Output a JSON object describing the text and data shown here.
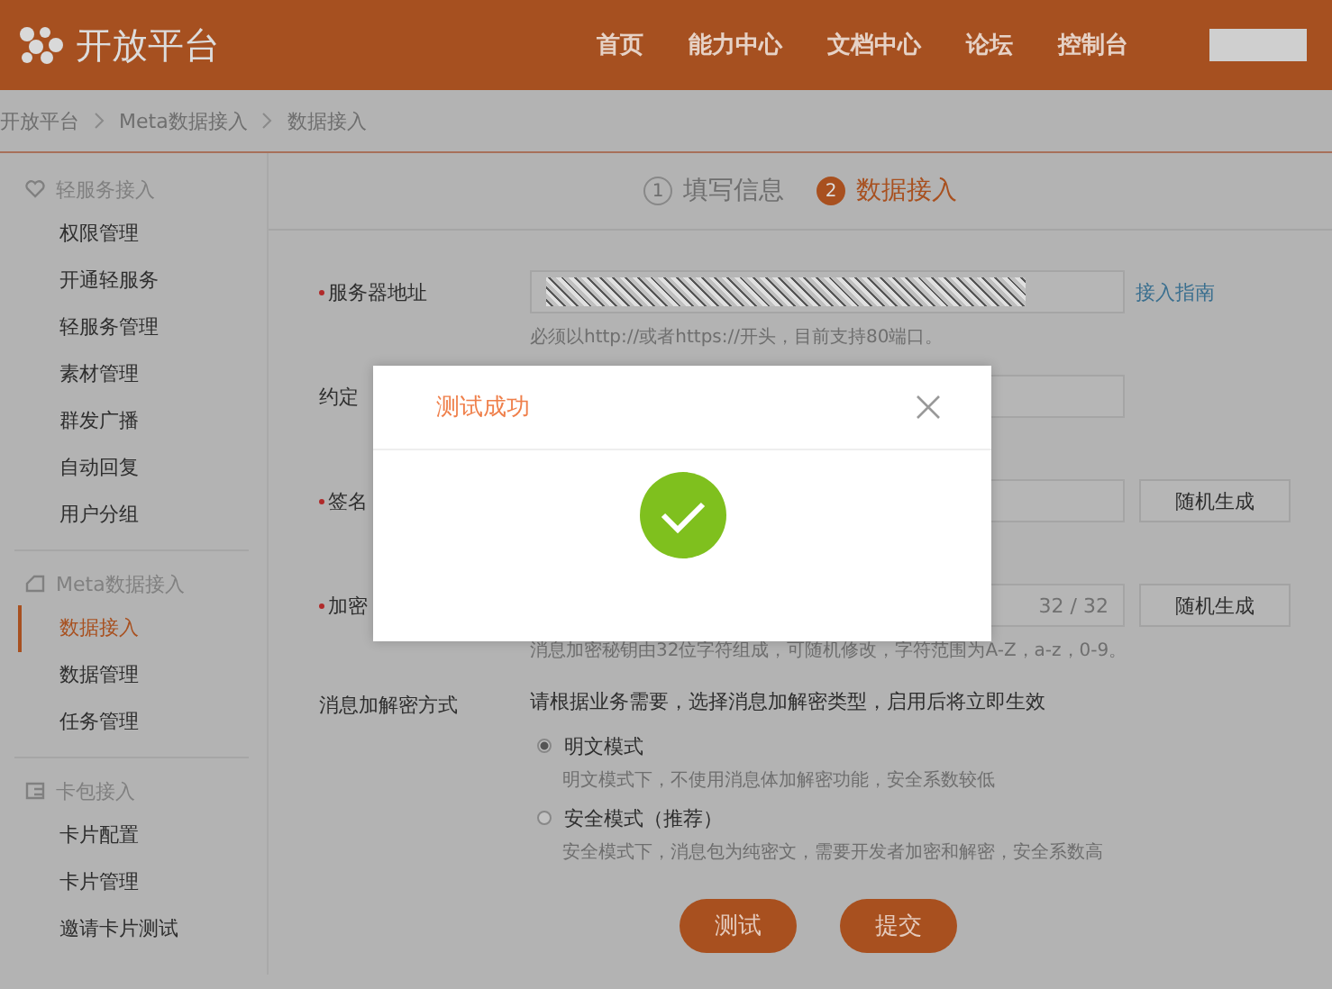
{
  "header": {
    "logo": "开放平台",
    "nav": [
      "首页",
      "能力中心",
      "文档中心",
      "论坛",
      "控制台"
    ]
  },
  "breadcrumb": [
    "开放平台",
    "Meta数据接入",
    "数据接入"
  ],
  "sidebar": {
    "sections": [
      {
        "title": "轻服务接入",
        "kind": "heart",
        "items": [
          {
            "label": "权限管理",
            "selected": false
          },
          {
            "label": "开通轻服务",
            "selected": false
          },
          {
            "label": "轻服务管理",
            "selected": false
          },
          {
            "label": "素材管理",
            "selected": false
          },
          {
            "label": "群发广播",
            "selected": false
          },
          {
            "label": "自动回复",
            "selected": false
          },
          {
            "label": "用户分组",
            "selected": false
          }
        ]
      },
      {
        "title": "Meta数据接入",
        "kind": "tag",
        "items": [
          {
            "label": "数据接入",
            "selected": true
          },
          {
            "label": "数据管理",
            "selected": false
          },
          {
            "label": "任务管理",
            "selected": false
          }
        ]
      },
      {
        "title": "卡包接入",
        "kind": "card",
        "items": [
          {
            "label": "卡片配置",
            "selected": false
          },
          {
            "label": "卡片管理",
            "selected": false
          },
          {
            "label": "邀请卡片测试",
            "selected": false
          }
        ]
      }
    ]
  },
  "steps": [
    {
      "number": "1",
      "label": "填写信息",
      "selected": false
    },
    {
      "number": "2",
      "label": "数据接入",
      "selected": true
    }
  ],
  "form": {
    "rows": [
      {
        "label": "服务器地址",
        "required": true,
        "obscured": true,
        "link": "接入指南",
        "hint": "必须以http://或者https://开头，目前支持80端口。"
      },
      {
        "label": "约定"
      },
      {
        "label": "签名",
        "required": true,
        "button": "随机生成"
      },
      {
        "label": "加密",
        "required": true,
        "counter": "32 / 32",
        "button": "随机生成",
        "hint": "消息加密秘钥由32位字符组成，可随机修改，字符范围为A-Z，a-z，0-9。"
      }
    ],
    "mode": {
      "label": "消息加解密方式",
      "intro": "请根据业务需要，选择消息加解密类型，启用后将立即生效",
      "options": [
        {
          "label": "明文模式",
          "selected": true,
          "desc": "明文模式下，不使用消息体加解密功能，安全系数较低"
        },
        {
          "label": "安全模式（推荐）",
          "selected": false,
          "desc": "安全模式下，消息包为纯密文，需要开发者加密和解密，安全系数高"
        }
      ]
    },
    "buttons": [
      "测试",
      "提交"
    ]
  },
  "modal": {
    "title": "测试成功",
    "success": true
  }
}
